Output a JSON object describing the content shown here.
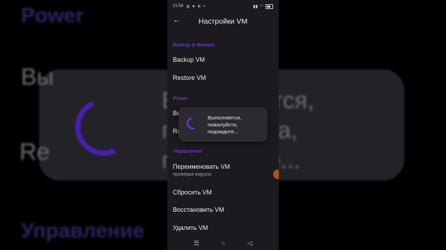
{
  "background": {
    "power_text": "Power",
    "vy_text": "Вы",
    "re_text": "Re",
    "message_text": "Выполняется,\nпожалуйста,\nподождите...",
    "manage_text": "Управление"
  },
  "status_bar": {
    "time": "21:54",
    "icons": [
      "whatsapp-icon",
      "heart-icon",
      "settings-icon",
      "dot-icon",
      "signal-icon",
      "wifi-icon",
      "battery-icon"
    ]
  },
  "app_bar": {
    "back_icon": "arrow-left-icon",
    "title": "Настройки VM"
  },
  "sections": {
    "backup": {
      "header": "Backup & Restore",
      "items": [
        "Backup VM",
        "Restore VM"
      ]
    },
    "power": {
      "header": "Power",
      "items": [
        "Вы",
        "Re"
      ]
    },
    "manage": {
      "header": "Управление",
      "rename_title": "Переименовать VM",
      "rename_subtitle": "проверка вирусы",
      "reset": "Сбросить VM",
      "restore": "Восстановить VM",
      "delete": "Удалить VM"
    }
  },
  "dialog": {
    "message": "Выполняется,\nпожалуйста,\nподождите..."
  },
  "nav_bar": {
    "recent": "☰",
    "home": "○",
    "back": "◁"
  },
  "colors": {
    "accent": "#7b47f0",
    "surface": "#1b1a1f",
    "dialog": "#2b2a30"
  }
}
